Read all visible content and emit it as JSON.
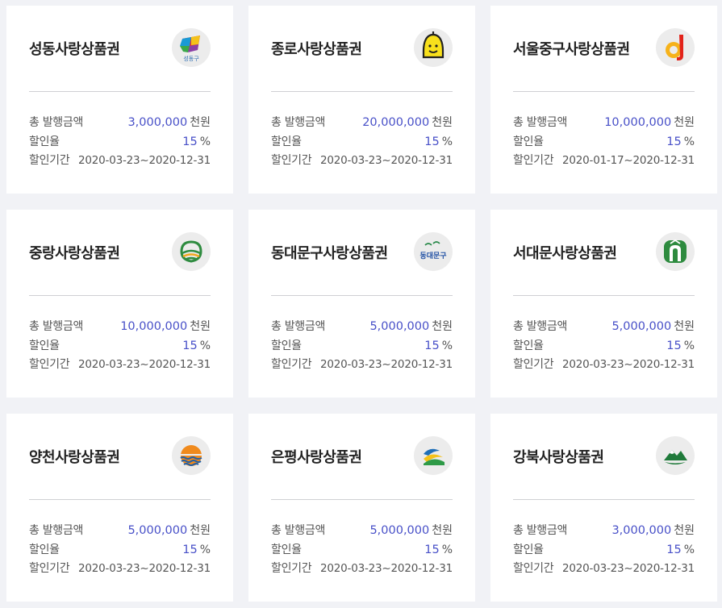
{
  "labels": {
    "total": "총 발행금액",
    "rate": "할인율",
    "period": "할인기간",
    "amount_unit": "천원",
    "rate_unit": "%"
  },
  "cards": [
    {
      "title": "성동사랑상품권",
      "amount": "3,000,000",
      "rate": "15",
      "period": "2020-03-23~2020-12-31",
      "logo": "seongdong-logo-icon",
      "logo_text": "성동구"
    },
    {
      "title": "종로사랑상품권",
      "amount": "20,000,000",
      "rate": "15",
      "period": "2020-03-23~2020-12-31",
      "logo": "jongno-bell-logo-icon"
    },
    {
      "title": "서울중구사랑상품권",
      "amount": "10,000,000",
      "rate": "15",
      "period": "2020-01-17~2020-12-31",
      "logo": "junggu-logo-icon"
    },
    {
      "title": "중랑사랑상품권",
      "amount": "10,000,000",
      "rate": "15",
      "period": "2020-03-23~2020-12-31",
      "logo": "jungnang-logo-icon"
    },
    {
      "title": "동대문구사랑상품권",
      "amount": "5,000,000",
      "rate": "15",
      "period": "2020-03-23~2020-12-31",
      "logo": "dongdaemun-logo-icon",
      "logo_text": "동대문구"
    },
    {
      "title": "서대문사랑상품권",
      "amount": "5,000,000",
      "rate": "15",
      "period": "2020-03-23~2020-12-31",
      "logo": "seodaemun-logo-icon"
    },
    {
      "title": "양천사랑상품권",
      "amount": "5,000,000",
      "rate": "15",
      "period": "2020-03-23~2020-12-31",
      "logo": "yangcheon-sun-logo-icon"
    },
    {
      "title": "은평사랑상품권",
      "amount": "5,000,000",
      "rate": "15",
      "period": "2020-03-23~2020-12-31",
      "logo": "eunpyeong-logo-icon"
    },
    {
      "title": "강북사랑상품권",
      "amount": "3,000,000",
      "rate": "15",
      "period": "2020-03-23~2020-12-31",
      "logo": "gangbuk-mountain-logo-icon"
    }
  ],
  "colors": {
    "amount": "#4850c8",
    "page_bg": "#f1f2f6",
    "card_bg": "#ffffff"
  }
}
